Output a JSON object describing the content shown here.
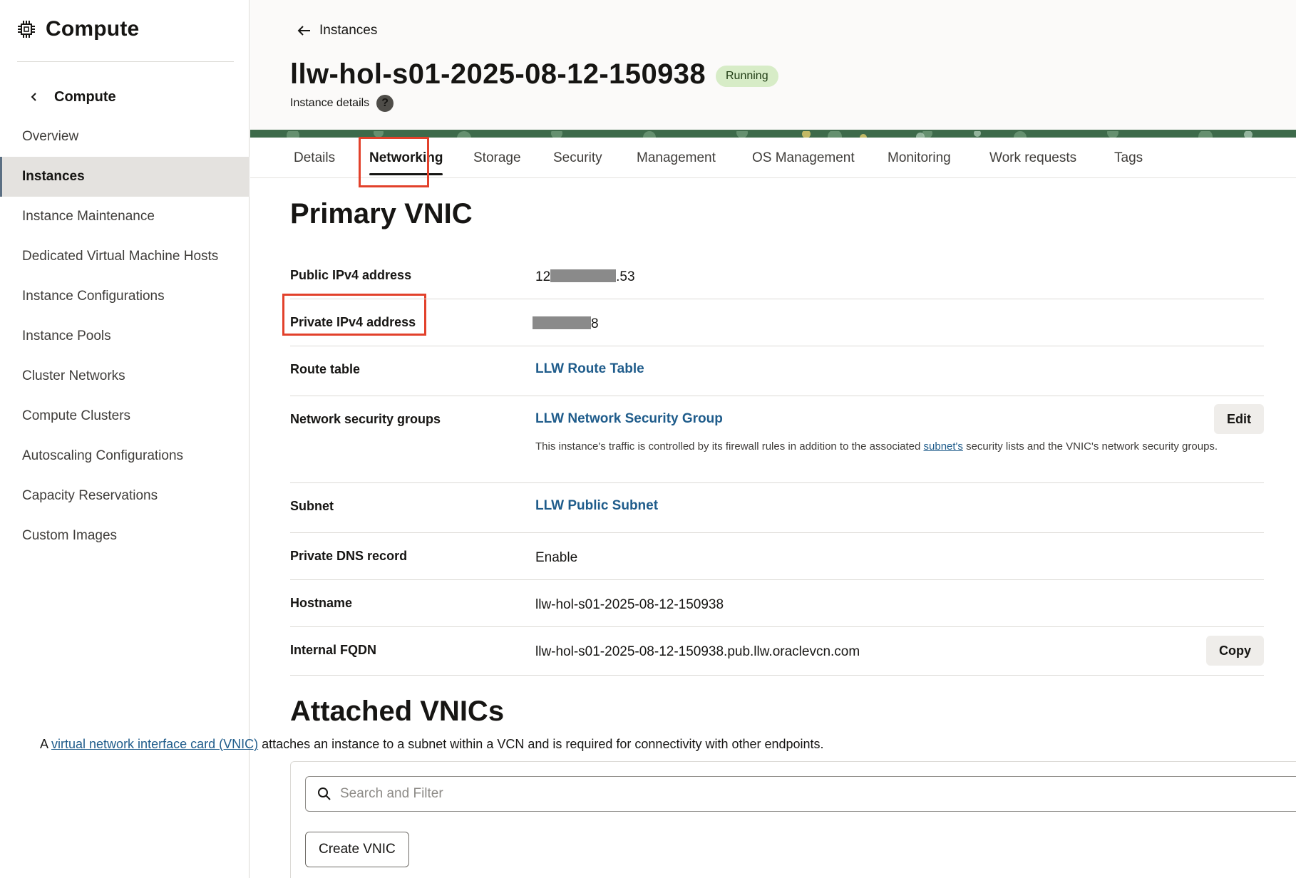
{
  "sidebar": {
    "title": "Compute",
    "back_label": "Compute",
    "items": [
      {
        "label": "Overview"
      },
      {
        "label": "Instances",
        "active": true
      },
      {
        "label": "Instance Maintenance"
      },
      {
        "label": "Dedicated Virtual Machine Hosts"
      },
      {
        "label": "Instance Configurations"
      },
      {
        "label": "Instance Pools"
      },
      {
        "label": "Cluster Networks"
      },
      {
        "label": "Compute Clusters"
      },
      {
        "label": "Autoscaling Configurations"
      },
      {
        "label": "Capacity Reservations"
      },
      {
        "label": "Custom Images"
      }
    ]
  },
  "header": {
    "back_label": "Instances",
    "title": "llw-hol-s01-2025-08-12-150938",
    "status": "Running",
    "subtitle": "Instance details",
    "help_glyph": "?"
  },
  "tabs": [
    {
      "label": "Details"
    },
    {
      "label": "Networking",
      "active": true
    },
    {
      "label": "Storage"
    },
    {
      "label": "Security"
    },
    {
      "label": "Management"
    },
    {
      "label": "OS Management"
    },
    {
      "label": "Monitoring"
    },
    {
      "label": "Work requests"
    },
    {
      "label": "Tags"
    }
  ],
  "primary_vnic": {
    "title": "Primary VNIC",
    "public_ip": {
      "label": "Public IPv4 address",
      "prefix": "12",
      "suffix": ".53"
    },
    "private_ip": {
      "label": "Private IPv4 address",
      "suffix": "8"
    },
    "route_table": {
      "label": "Route table",
      "value": "LLW Route Table"
    },
    "nsg": {
      "label": "Network security groups",
      "value": "LLW Network Security Group",
      "note_before": "This instance's traffic is controlled by its firewall rules in addition to the associated ",
      "note_link": "subnet's",
      "note_after": " security lists and the VNIC's network security groups.",
      "edit_label": "Edit"
    },
    "subnet": {
      "label": "Subnet",
      "value": "LLW Public Subnet"
    },
    "dns": {
      "label": "Private DNS record",
      "value": "Enable"
    },
    "hostname": {
      "label": "Hostname",
      "value": "llw-hol-s01-2025-08-12-150938"
    },
    "fqdn": {
      "label": "Internal FQDN",
      "value": "llw-hol-s01-2025-08-12-150938.pub.llw.oraclevcn.com",
      "copy_label": "Copy"
    }
  },
  "attached_vnics": {
    "title": "Attached VNICs",
    "desc_before": "A ",
    "desc_link": "virtual network interface card (VNIC)",
    "desc_after": " attaches an instance to a subnet within a VCN and is required for connectivity with other endpoints.",
    "search_placeholder": "Search and Filter",
    "create_label": "Create VNIC"
  },
  "colors": {
    "accent_link": "#1f5c8b",
    "status_running_bg": "#d7ecc7",
    "highlight_box": "#e2412b"
  },
  "icons": {
    "sidebar_logo": "chip-icon",
    "back": "chevron-left-icon",
    "header_back": "arrow-left-icon",
    "help": "help-icon",
    "search": "search-icon"
  }
}
